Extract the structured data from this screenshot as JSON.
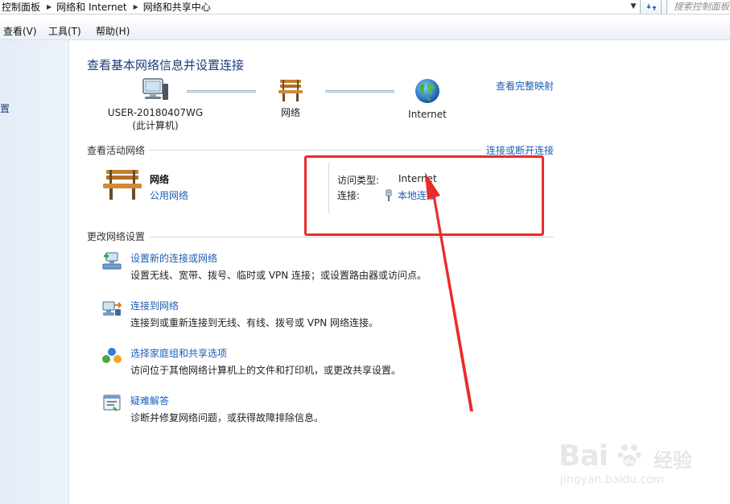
{
  "address_bar": {
    "breadcrumbs": [
      "控制面板",
      "网络和 Internet",
      "网络和共享中心"
    ],
    "search_placeholder": "搜索控制面板"
  },
  "menubar": {
    "items": [
      "查看(V)",
      "工具(T)",
      "帮助(H)"
    ]
  },
  "left_pane": {
    "link_fragment": "置"
  },
  "main": {
    "title": "查看基本网络信息并设置连接",
    "view_full_map": "查看完整映射",
    "network_map": {
      "computer_name": "USER-20180407WG",
      "computer_sub": "(此计算机)",
      "network_label": "网络",
      "internet_label": "Internet"
    },
    "active_section": {
      "header": "查看活动网络",
      "action_link": "连接或断开连接",
      "network_name": "网络",
      "network_type": "公用网络",
      "access_type_label": "访问类型:",
      "access_type_value": "Internet",
      "connection_label": "连接:",
      "connection_value": "本地连接"
    },
    "change_section": {
      "header": "更改网络设置",
      "tasks": [
        {
          "icon": "new-connection-icon",
          "link": "设置新的连接或网络",
          "desc": "设置无线、宽带、拨号、临时或 VPN 连接；或设置路由器或访问点。"
        },
        {
          "icon": "connect-network-icon",
          "link": "连接到网络",
          "desc": "连接到或重新连接到无线、有线、拨号或 VPN 网络连接。"
        },
        {
          "icon": "homegroup-icon",
          "link": "选择家庭组和共享选项",
          "desc": "访问位于其他网络计算机上的文件和打印机，或更改共享设置。"
        },
        {
          "icon": "troubleshoot-icon",
          "link": "疑难解答",
          "desc": "诊断并修复网络问题，或获得故障排除信息。"
        }
      ]
    }
  },
  "annotation": {
    "color": "#ea2b2b"
  },
  "watermark": {
    "brand": "Bai",
    "brand_suffix": "经验",
    "url": "jingyan.baidu.com"
  },
  "colors": {
    "link": "#1a5fb4",
    "title": "#1e3c78",
    "nav_bg": "#e4ecf6"
  }
}
